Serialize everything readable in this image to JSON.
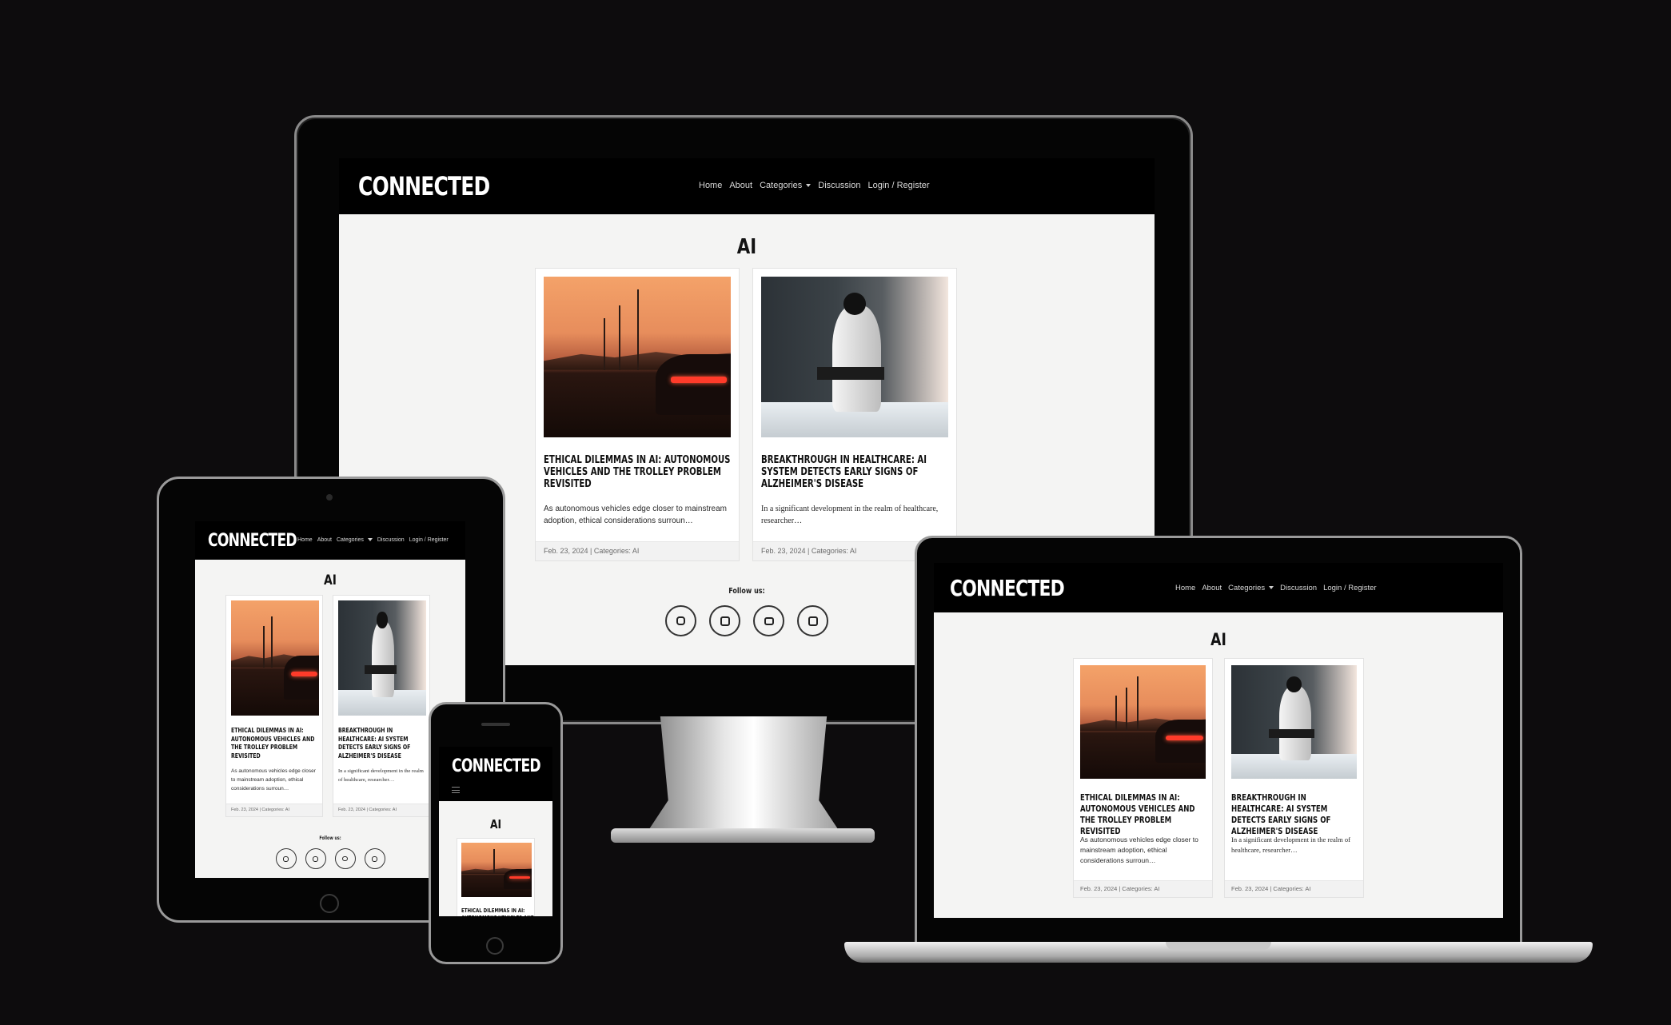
{
  "site": {
    "brand": "CONNECTED",
    "nav": [
      "Home",
      "About",
      "Categories",
      "Discussion",
      "Login / Register"
    ],
    "page_title": "AI",
    "follow_label": "Follow us:",
    "social_icons": [
      "instagram-icon",
      "facebook-icon",
      "youtube-icon",
      "linkedin-icon"
    ],
    "posts": [
      {
        "title": "Ethical Dilemmas in AI: Autonomous Vehicles and the Trolley Problem Revisited",
        "excerpt": "As autonomous vehicles edge closer to mainstream adoption, ethical considerations surroun…",
        "meta": "Feb. 23, 2024 | Categories: AI"
      },
      {
        "title": "Breakthrough in Healthcare: AI System Detects Early Signs of Alzheimer's Disease",
        "excerpt": "In a significant development in the realm of healthcare, researcher…",
        "meta": "Feb. 23, 2024 | Categories: AI"
      }
    ]
  },
  "colors": {
    "background": "#0d0c0d",
    "nav": "#000000",
    "page": "#f4f4f3"
  },
  "devices": [
    "desktop-monitor",
    "tablet",
    "laptop",
    "phone"
  ]
}
